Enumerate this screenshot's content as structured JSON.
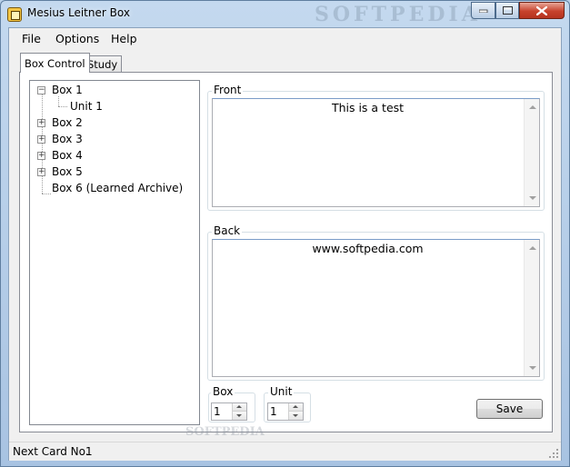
{
  "window": {
    "title": "Mesius Leitner Box",
    "watermark": "SOFTPEDIA"
  },
  "menu": [
    "File",
    "Options",
    "Help"
  ],
  "tabs": [
    {
      "label": "Box Control",
      "active": true
    },
    {
      "label": "Study",
      "active": false
    }
  ],
  "tree": [
    {
      "label": "Box 1",
      "expanded": true,
      "children": [
        {
          "label": "Unit 1"
        }
      ]
    },
    {
      "label": "Box 2",
      "expanded": false
    },
    {
      "label": "Box 3",
      "expanded": false
    },
    {
      "label": "Box 4",
      "expanded": false
    },
    {
      "label": "Box 5",
      "expanded": false
    },
    {
      "label": "Box 6 (Learned Archive)",
      "expanded": null
    }
  ],
  "front": {
    "label": "Front",
    "text": "This is a test"
  },
  "back": {
    "label": "Back",
    "text": "www.softpedia.com"
  },
  "box_selector": {
    "label": "Box",
    "value": "1"
  },
  "unit_selector": {
    "label": "Unit",
    "value": "1"
  },
  "save_label": "Save",
  "status": {
    "label": "Next Card No.",
    "value": "1"
  },
  "watermark_small": "www.softpedia.com"
}
